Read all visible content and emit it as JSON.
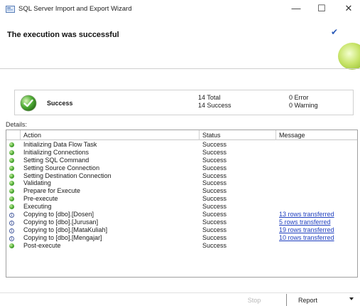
{
  "window": {
    "title": "SQL Server Import and Export Wizard",
    "minimize_glyph": "—",
    "maximize_glyph": "☐",
    "close_glyph": "✕"
  },
  "header": {
    "title": "The execution was successful",
    "check_glyph": "✔"
  },
  "summary": {
    "status_label": "Success",
    "total": "14 Total",
    "success": "14 Success",
    "error": "0 Error",
    "warning": "0 Warning"
  },
  "details": {
    "label": "Details:",
    "columns": [
      "Action",
      "Status",
      "Message"
    ],
    "rows": [
      {
        "icon": "success-icon",
        "action": "Initializing Data Flow Task",
        "status": "Success",
        "message": ""
      },
      {
        "icon": "success-icon",
        "action": "Initializing Connections",
        "status": "Success",
        "message": ""
      },
      {
        "icon": "success-icon",
        "action": "Setting SQL Command",
        "status": "Success",
        "message": ""
      },
      {
        "icon": "success-icon",
        "action": "Setting Source Connection",
        "status": "Success",
        "message": ""
      },
      {
        "icon": "success-icon",
        "action": "Setting Destination Connection",
        "status": "Success",
        "message": ""
      },
      {
        "icon": "success-icon",
        "action": "Validating",
        "status": "Success",
        "message": ""
      },
      {
        "icon": "success-icon",
        "action": "Prepare for Execute",
        "status": "Success",
        "message": ""
      },
      {
        "icon": "success-icon",
        "action": "Pre-execute",
        "status": "Success",
        "message": ""
      },
      {
        "icon": "success-icon",
        "action": "Executing",
        "status": "Success",
        "message": ""
      },
      {
        "icon": "info-icon",
        "action": "Copying to [dbo].[Dosen]",
        "status": "Success",
        "message": "13 rows transferred"
      },
      {
        "icon": "info-icon",
        "action": "Copying to [dbo].[Jurusan]",
        "status": "Success",
        "message": "5 rows transferred"
      },
      {
        "icon": "info-icon",
        "action": "Copying to [dbo].[MataKuliah]",
        "status": "Success",
        "message": "19 rows transferred"
      },
      {
        "icon": "info-icon",
        "action": "Copying to [dbo].[Mengajar]",
        "status": "Success",
        "message": "10 rows transferred"
      },
      {
        "icon": "success-icon",
        "action": "Post-execute",
        "status": "Success",
        "message": ""
      }
    ]
  },
  "buttons": {
    "stop": "Stop",
    "report": "Report"
  },
  "colors": {
    "success_green": "#4aa832",
    "link_blue": "#1f3fbf"
  }
}
